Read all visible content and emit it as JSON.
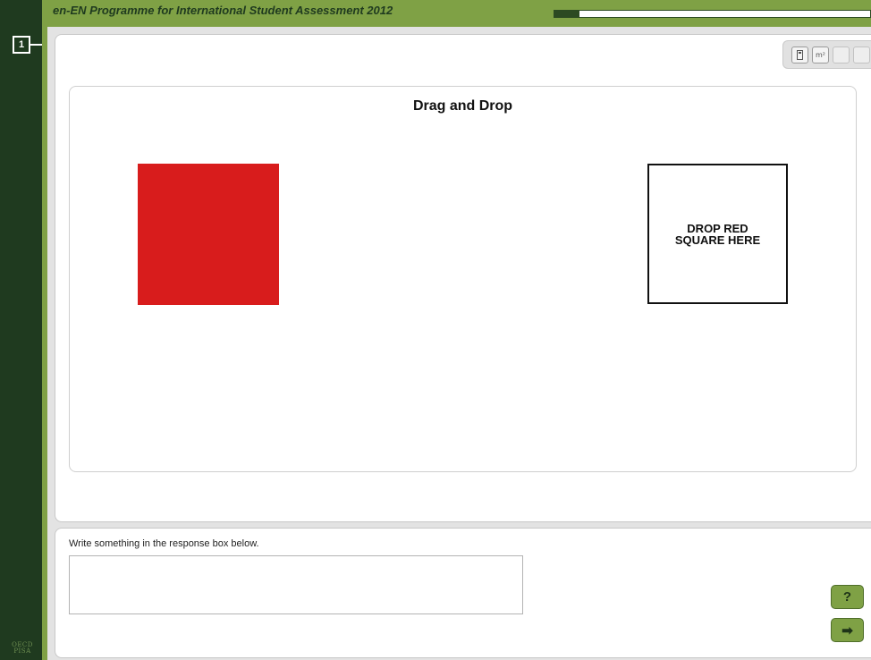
{
  "header": {
    "title": "en-EN Programme for International Student Assessment 2012",
    "progress_fraction": 0.08
  },
  "sidebar": {
    "page_number": "1",
    "logo_text": "OECD PISA"
  },
  "toolbox": {
    "buttons": [
      {
        "icon": "calculator-icon",
        "enabled": true
      },
      {
        "icon": "area-unit-icon",
        "label": "m²",
        "enabled": true
      },
      {
        "icon": "disabled-tool-icon",
        "enabled": false
      },
      {
        "icon": "disabled-tool-icon",
        "enabled": false
      }
    ]
  },
  "stimulus": {
    "title": "Drag and Drop",
    "drag_item": {
      "name": "red square",
      "color": "#d81c1c"
    },
    "drop_target": {
      "label": "DROP RED SQUARE HERE"
    }
  },
  "response": {
    "prompt": "Write something in the response box below.",
    "value": ""
  },
  "navigation": {
    "help_label": "?",
    "next_label": "➡"
  },
  "colors": {
    "brand_green": "#7fa145",
    "dark_green": "#1f3a1f",
    "accent_red": "#d81c1c"
  }
}
